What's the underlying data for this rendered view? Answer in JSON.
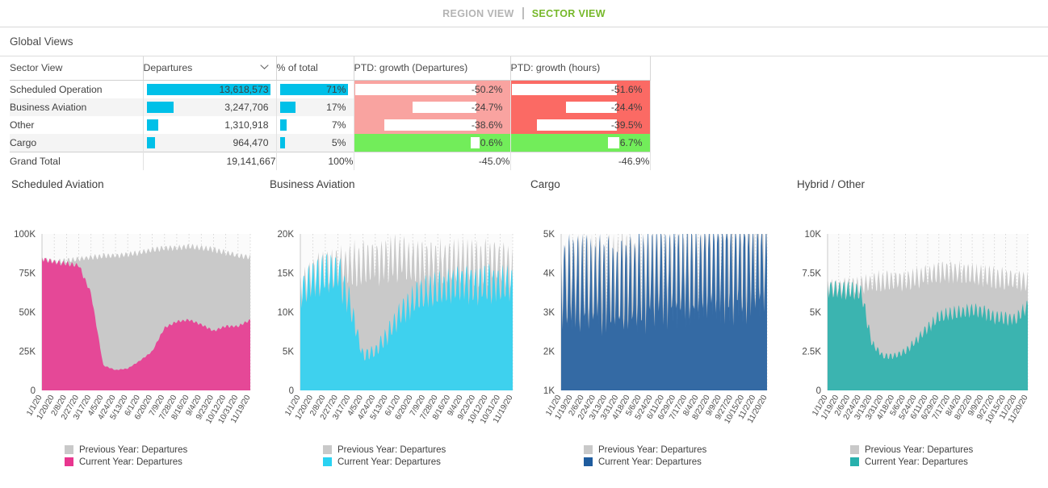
{
  "topnav": {
    "items": [
      {
        "label": "REGION VIEW",
        "active": false
      },
      {
        "label": "SECTOR VIEW",
        "active": true
      }
    ],
    "active_color": "#76b82a",
    "inactive_color": "#b4b4b4"
  },
  "panel": {
    "title": "Global Views"
  },
  "table": {
    "columns": [
      "Sector View",
      "Departures",
      "% of total",
      "PTD: growth (Departures)",
      "PTD: growth (hours)"
    ],
    "sorted_column": "Departures",
    "sort_icon": "chevron-down-icon",
    "bar_color": "#00c0e8",
    "neg_bg_departures": "#f9a3a0",
    "neg_bg_hours": "#fb6a64",
    "pos_bg": "#72ed5a",
    "rows": [
      {
        "sector": "Scheduled Operation",
        "departures": "13,618,573",
        "departures_value": 13618573,
        "pct_of_total": "71%",
        "pct_value": 71,
        "ptd_departures": "-50.2%",
        "ptd_departures_value": -50.2,
        "ptd_hours": "-51.6%",
        "ptd_hours_value": -51.6
      },
      {
        "sector": "Business Aviation",
        "departures": "3,247,706",
        "departures_value": 3247706,
        "pct_of_total": "17%",
        "pct_value": 17,
        "ptd_departures": "-24.7%",
        "ptd_departures_value": -24.7,
        "ptd_hours": "-24.4%",
        "ptd_hours_value": -24.4
      },
      {
        "sector": "Other",
        "departures": "1,310,918",
        "departures_value": 1310918,
        "pct_of_total": "7%",
        "pct_value": 7,
        "ptd_departures": "-38.6%",
        "ptd_departures_value": -38.6,
        "ptd_hours": "-39.5%",
        "ptd_hours_value": -39.5
      },
      {
        "sector": "Cargo",
        "departures": "964,470",
        "departures_value": 964470,
        "pct_of_total": "5%",
        "pct_value": 5,
        "ptd_departures": "0.6%",
        "ptd_departures_value": 0.6,
        "ptd_hours": "6.7%",
        "ptd_hours_value": 6.7
      }
    ],
    "total": {
      "sector": "Grand Total",
      "departures": "19,141,667",
      "pct_of_total": "100%",
      "ptd_departures": "-45.0%",
      "ptd_hours": "-46.9%"
    }
  },
  "legend_labels": {
    "previous": "Previous Year: Departures",
    "current": "Current Year: Departures",
    "previous_color": "#c4c4c4"
  },
  "chart_data": [
    {
      "type": "area",
      "title": "Scheduled Aviation",
      "xlabel": "",
      "ylabel": "",
      "ylim": [
        0,
        100000
      ],
      "yticks": [
        0,
        25000,
        50000,
        75000,
        100000
      ],
      "ytick_labels": [
        "0",
        "25K",
        "50K",
        "75K",
        "100K"
      ],
      "grid": true,
      "legend_position": "bottom",
      "current_color": "#e8368f",
      "previous_color": "#c9c9c9",
      "x": [
        "1/1/20",
        "1/20/20",
        "2/8/20",
        "2/27/20",
        "3/17/20",
        "4/5/20",
        "4/24/20",
        "5/13/20",
        "6/1/20",
        "6/20/20",
        "7/9/20",
        "7/28/20",
        "8/16/20",
        "9/4/20",
        "9/23/20",
        "10/12/20",
        "10/31/20",
        "11/19/20"
      ],
      "series": [
        {
          "name": "Previous Year: Departures",
          "values": [
            84000,
            82000,
            83000,
            84000,
            85000,
            86000,
            86000,
            87000,
            88000,
            90000,
            91000,
            91000,
            92000,
            91000,
            90000,
            88000,
            86000,
            85000
          ]
        },
        {
          "name": "Current Year: Departures",
          "values": [
            84000,
            82000,
            81000,
            80000,
            62000,
            16000,
            13000,
            14000,
            19000,
            25000,
            40000,
            44000,
            45000,
            42000,
            38000,
            41000,
            41000,
            45000
          ]
        }
      ]
    },
    {
      "type": "area",
      "title": "Business Aviation",
      "xlabel": "",
      "ylabel": "",
      "ylim": [
        0,
        20000
      ],
      "yticks": [
        0,
        5000,
        10000,
        15000,
        20000
      ],
      "ytick_labels": [
        "0",
        "5K",
        "10K",
        "15K",
        "20K"
      ],
      "grid": true,
      "legend_position": "bottom",
      "current_color": "#2ad2f2",
      "previous_color": "#c9c9c9",
      "x": [
        "1/1/20",
        "1/20/20",
        "2/8/20",
        "2/27/20",
        "3/17/20",
        "4/5/20",
        "4/24/20",
        "5/13/20",
        "6/1/20",
        "6/20/20",
        "7/9/20",
        "7/28/20",
        "8/16/20",
        "9/4/20",
        "9/23/20",
        "10/12/20",
        "10/31/20",
        "11/19/20"
      ],
      "series": [
        {
          "name": "Previous Year: Departures",
          "values": [
            13000,
            14500,
            15200,
            15600,
            16000,
            16200,
            16400,
            16800,
            17000,
            16600,
            16400,
            16300,
            16200,
            16400,
            16100,
            16200,
            16300,
            15300
          ]
        },
        {
          "name": "Current Year: Departures",
          "values": [
            12500,
            14200,
            15000,
            15200,
            11000,
            4500,
            5000,
            7200,
            9800,
            11500,
            12500,
            13000,
            13200,
            13600,
            13400,
            13800,
            13600,
            13500
          ]
        }
      ]
    },
    {
      "type": "area",
      "title": "Cargo",
      "xlabel": "",
      "ylabel": "",
      "ylim": [
        1000,
        5000
      ],
      "yticks": [
        1000,
        2000,
        3000,
        4000,
        5000
      ],
      "ytick_labels": [
        "1K",
        "2K",
        "3K",
        "4K",
        "5K"
      ],
      "grid": true,
      "legend_position": "bottom",
      "current_color": "#1f5c9e",
      "previous_color": "#c9c9c9",
      "x": [
        "1/1/20",
        "1/19/20",
        "2/6/20",
        "2/24/20",
        "3/13/20",
        "3/31/20",
        "4/18/20",
        "5/6/20",
        "5/24/20",
        "6/11/20",
        "6/29/20",
        "7/17/20",
        "8/4/20",
        "8/22/20",
        "9/9/20",
        "9/27/20",
        "10/15/20",
        "11/2/20",
        "11/20/20"
      ],
      "series": [
        {
          "name": "Previous Year: Departures",
          "values": [
            3600,
            3750,
            3800,
            3820,
            3900,
            3950,
            3900,
            3850,
            3900,
            3950,
            3950,
            3980,
            3990,
            4000,
            4050,
            4080,
            4100,
            4150,
            4200
          ]
        },
        {
          "name": "Current Year: Departures",
          "values": [
            3750,
            3820,
            3800,
            3820,
            3800,
            3780,
            3800,
            3850,
            3980,
            4050,
            4050,
            4080,
            4100,
            4150,
            4200,
            4250,
            4280,
            4300,
            4350
          ]
        }
      ]
    },
    {
      "type": "area",
      "title": "Hybrid / Other",
      "xlabel": "",
      "ylabel": "",
      "ylim": [
        0,
        10000
      ],
      "yticks": [
        0,
        2500,
        5000,
        7500,
        10000
      ],
      "ytick_labels": [
        "0",
        "2.5K",
        "5K",
        "7.5K",
        "10K"
      ],
      "grid": true,
      "legend_position": "bottom",
      "current_color": "#27b0ac",
      "previous_color": "#c9c9c9",
      "x": [
        "1/1/20",
        "1/19/20",
        "2/6/20",
        "2/24/20",
        "3/13/20",
        "3/31/20",
        "4/18/20",
        "5/6/20",
        "5/24/20",
        "6/11/20",
        "6/29/20",
        "7/17/20",
        "8/4/20",
        "8/22/20",
        "9/9/20",
        "9/27/20",
        "10/15/20",
        "11/2/20",
        "11/20/20"
      ],
      "series": [
        {
          "name": "Previous Year: Departures",
          "values": [
            6600,
            6500,
            6600,
            6700,
            6900,
            7000,
            7000,
            7050,
            7200,
            7400,
            7600,
            7600,
            7500,
            7400,
            7300,
            7200,
            7100,
            7000,
            6900
          ]
        },
        {
          "name": "Current Year: Departures",
          "values": [
            6500,
            6400,
            6400,
            6300,
            3000,
            2200,
            2200,
            2500,
            3200,
            4000,
            4700,
            4900,
            5000,
            5100,
            5000,
            4700,
            4600,
            4600,
            5400
          ]
        }
      ]
    }
  ]
}
